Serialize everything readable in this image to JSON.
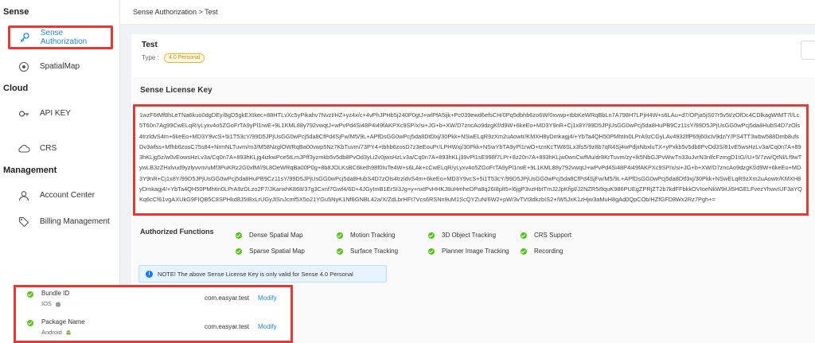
{
  "sidebar": {
    "sections": [
      {
        "title": "Sense"
      },
      {
        "title": "Cloud"
      },
      {
        "title": "Management"
      }
    ],
    "items": [
      {
        "label": "Sense Authorization",
        "icon": "key-icon"
      },
      {
        "label": "SpatialMap",
        "icon": "spatial-map-icon"
      },
      {
        "label": "API KEY",
        "icon": "api-key-icon"
      },
      {
        "label": "CRS",
        "icon": "cloud-icon"
      },
      {
        "label": "Account Center",
        "icon": "user-icon"
      },
      {
        "label": "Billing Management",
        "icon": "tag-icon"
      }
    ]
  },
  "breadcrumb": "Sense Authorization > Test",
  "license": {
    "title": "Test",
    "type_label": "Type :",
    "type_value": "4.0 Personal",
    "section_title": "Sense License Key",
    "key": "1wzF6tMf8hLeTNa6kuo0dgDEy/8gD5gkEXtkec+88HTLvXc5yPikahv7NvzI/HZ+yz4x/c+4vPhJPHb5j240P0gtJ+wlPfA5ijk+Pc039ewd6efsCH/0Pq5dbhb6zo6W/0xvwp+tbbKeWRqBbLn7A798H7LPjH4W+s6LAu+d7/OPja5jS07r5v5t/zOfDc4CDlkagWtMT7l/Lc5T60n7Ag99CwELqR/yLyxv4o5ZGoFrTA9yPl1rwE+9L1KML88y792vwqtJ+wPvPd4Si48P4i49fAKPXc9SP/x/si+JG+b+XW/D7zncAo9dzgKf/d9W+6keEo+MD3Y9nR+Cj1x8Y/99D5JPjUsGG0wPcj5da8HuPB9Cz11sY/99D5JPjUsGG0wPcj5da8HubS4D7zOls4trzldvS4m+6keEo+MD3Y9vcS+5i1T53cY/99D5JPjUsGG0wPcj5da8CfPd4SjFw/M5/9L+APfDsGG0wPcj5da8Dtf3xj/30Pkk+NSwELqR9zXm2uAowtr/KMXH8yDmkagj4/+YbTa4QH50PMhtIn0LPrA9zCGyLAv4932lfP69j60iclv9dz/Y/PS4TT3wbw588Dmb8ufsDv3wfss+Mfhb6zosC75s84+NrmNLTuvm/m3/M58NzglOWRqBa00vwp5Nz7KbTuvm/73PY4+tbhb6zosD7z3eEouPr/LPHWxj/30Pkk+NSwYbTA9yPl1rwO+tznKcTW8SLx3fs5/9z8b7qR4Sj4wPdjxNbxluTX+yPxkb5v5db8PvOd3S/81vE5wsHzLv3a/Cq0n7A+893hKLjg5z/w0vEowsHzLv3a/Cq0n7A+893hKLjg4izkwPce5tLmJPff3yzmkb5v5db8PvOd3yLi2v0jwsHzLv3a/Cq0n7A+893hKLj39vPl1sE998f7LPr+8z20n7A+893hKLjw0wnCwfMu/dr8KrTuvm/zy+lk5NbGJPvWwTn33uJvrN3nlfcFzmgD1tG//U+5/7zw/QtNl/Lf9wTywLB3zZHxlvud9yzlyvvm/uMf3PuKRz2G0xfM//9L8OeWRqBa00P0g+8b8JOLKsBC6keIh98f0IuTe4W+s6LAk+cCwELqR/yLyxv4o5ZGoFrTA9yPl1rwE+9L1KML88y792vwqtJ+wPvPd4Si48P4i49fAKPXc9SP/x/si+JG+b+XW/D7zncAo9dzgKf/d9W+6keEo+MD3Y9nR+Cj1x8Y/99D5JPjUsGG0wPcj5da8HuPB9Cz11sY/99D5JPjUsGG0wPcj5da8HubS4D7zOls4trzldvS4m+6keEo+MD3Y9vcS+5i1T53cY/99D5JPjUsGG0wPcj5da8CfPd4SjFw/M5/9L+APfDsGG0wPcj5da8Dtf3xj/30Pkk+NSwELqR9zXm2uAowtr/KMXH8yDmkagj4/+YbTa4QH50PMhtIn0LPrA9zDLzo2F7/JKanxhK868/37g3Cxnf7Gwf4/6D+4JGyImB1ErSI3Jg+y+nxtPvHHKJ8uHmheDPa8q26I8plt5+l6jgP3vzHbtTmJ2JpKfipl/J2NZR5i9quK986PUEgZPRjZT2b7kdFFbkkOVIoeNkW9iUi5HGELFvezYhwvIUF3aYQKq6cCf61vgAXUkG9FIQB5C8SPHkd8J5IBxLrUGyJlSnJcmf5X5o21YGu5NyK1Nf6GNBL42a/X/ZdLbrHFt7Vcs6RSNn9uM1ScQYZuN/6W2+pW/3vTVt3dkzbIS2+/W5JxK1zHjw3aMuH8gAd0QpCOb/HZfGFD8Wx2Rz7Pgh+=",
    "authorized_label": "Authorized Functions",
    "functions": [
      "Dense Spatial Map",
      "Motion Tracking",
      "3D Object Tracking",
      "CRS Support",
      "Sparse Spatial Map",
      "Surface Tracking",
      "Planner Image Tracking",
      "Recording"
    ],
    "note": "NOTE! The above Sense License Key is only valid for Sense 4.0 Personal",
    "ids": [
      {
        "name": "Bundle ID",
        "platform": "IOS",
        "platform_icon": "apple-icon",
        "value": "com.easyar.test",
        "action": "Modify"
      },
      {
        "name": "Package Name",
        "platform": "Android",
        "platform_icon": "android-icon",
        "value": "com.easyar.test",
        "action": "Modify"
      }
    ]
  },
  "colors": {
    "accent": "#1e8ad6",
    "highlight": "#e53935",
    "success": "#52c41a"
  }
}
